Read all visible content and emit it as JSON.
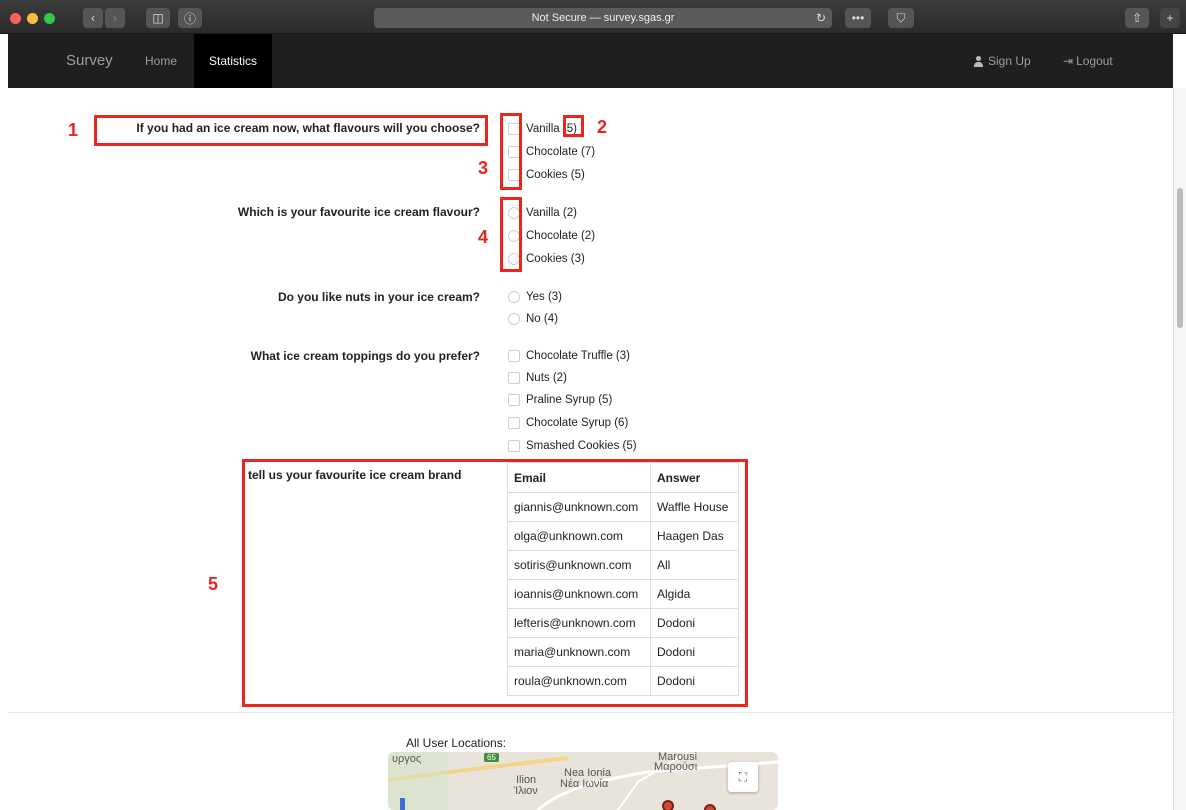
{
  "browser": {
    "url_text": "Not Secure — survey.sgas.gr"
  },
  "navbar": {
    "brand": "Survey",
    "home": "Home",
    "statistics": "Statistics",
    "sign_up": "Sign Up",
    "logout": "Logout"
  },
  "questions": {
    "q1": {
      "label": "If you had an ice cream now, what flavours will you choose?",
      "options": [
        "Vanilla (5)",
        "Chocolate (7)",
        "Cookies (5)"
      ]
    },
    "q2": {
      "label": "Which is your favourite ice cream flavour?",
      "options": [
        "Vanilla (2)",
        "Chocolate (2)",
        "Cookies (3)"
      ]
    },
    "q3": {
      "label": "Do you like nuts in your ice cream?",
      "options": [
        "Yes (3)",
        "No (4)"
      ]
    },
    "q4": {
      "label": "What ice cream toppings do you prefer?",
      "options": [
        "Chocolate Truffle (3)",
        "Nuts (2)",
        "Praline Syrup (5)",
        "Chocolate Syrup (6)",
        "Smashed Cookies (5)"
      ]
    },
    "q5": {
      "label": "tell us your favourite ice cream brand",
      "table": {
        "headers": [
          "Email",
          "Answer"
        ],
        "rows": [
          [
            "giannis@unknown.com",
            "Waffle House"
          ],
          [
            "olga@unknown.com",
            "Haagen Das"
          ],
          [
            "sotiris@unknown.com",
            "All"
          ],
          [
            "ioannis@unknown.com",
            "Algida"
          ],
          [
            "lefteris@unknown.com",
            "Dodoni"
          ],
          [
            "maria@unknown.com",
            "Dodoni"
          ],
          [
            "roula@unknown.com",
            "Dodoni"
          ]
        ]
      }
    }
  },
  "annotations": [
    "1",
    "2",
    "3",
    "4",
    "5"
  ],
  "map": {
    "label": "All User Locations:",
    "place_1": "Marousi",
    "place_1_gr": "Μαρούσι",
    "place_2": "Nea Ionia",
    "place_2_gr": "Νέα Ιωνία",
    "place_3": "Ilion",
    "place_3_gr": "Ίλιον",
    "place_4": "υργος",
    "road_badge": "65"
  },
  "colors": {
    "annotation_red": "#e8261c",
    "navbar_bg": "#1f1f1f"
  }
}
